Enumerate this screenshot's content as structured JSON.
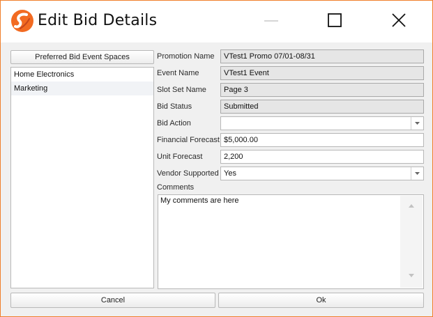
{
  "window": {
    "title": "Edit Bid Details",
    "accent": "#f07f2b",
    "icons": {
      "app": "app-logo-icon",
      "minimize": "minimize-icon",
      "maximize": "maximize-icon",
      "close": "close-icon"
    }
  },
  "spaces": {
    "header": "Preferred Bid Event Spaces",
    "items": [
      "Home Electronics",
      "Marketing"
    ]
  },
  "fields": {
    "promotion_name": {
      "label": "Promotion Name",
      "value": "VTest1 Promo 07/01-08/31"
    },
    "event_name": {
      "label": "Event Name",
      "value": "VTest1 Event"
    },
    "slot_set_name": {
      "label": "Slot Set Name",
      "value": "Page 3"
    },
    "bid_status": {
      "label": "Bid Status",
      "value": "Submitted"
    },
    "bid_action": {
      "label": "Bid Action",
      "value": ""
    },
    "financial_forecast": {
      "label": "Financial Forecast",
      "value": "$5,000.00"
    },
    "unit_forecast": {
      "label": "Unit Forecast",
      "value": "2,200"
    },
    "vendor_supported": {
      "label": "Vendor Supported",
      "value": "Yes"
    }
  },
  "comments": {
    "label": "Comments",
    "value": "My comments are here"
  },
  "buttons": {
    "cancel": "Cancel",
    "ok": "Ok"
  }
}
